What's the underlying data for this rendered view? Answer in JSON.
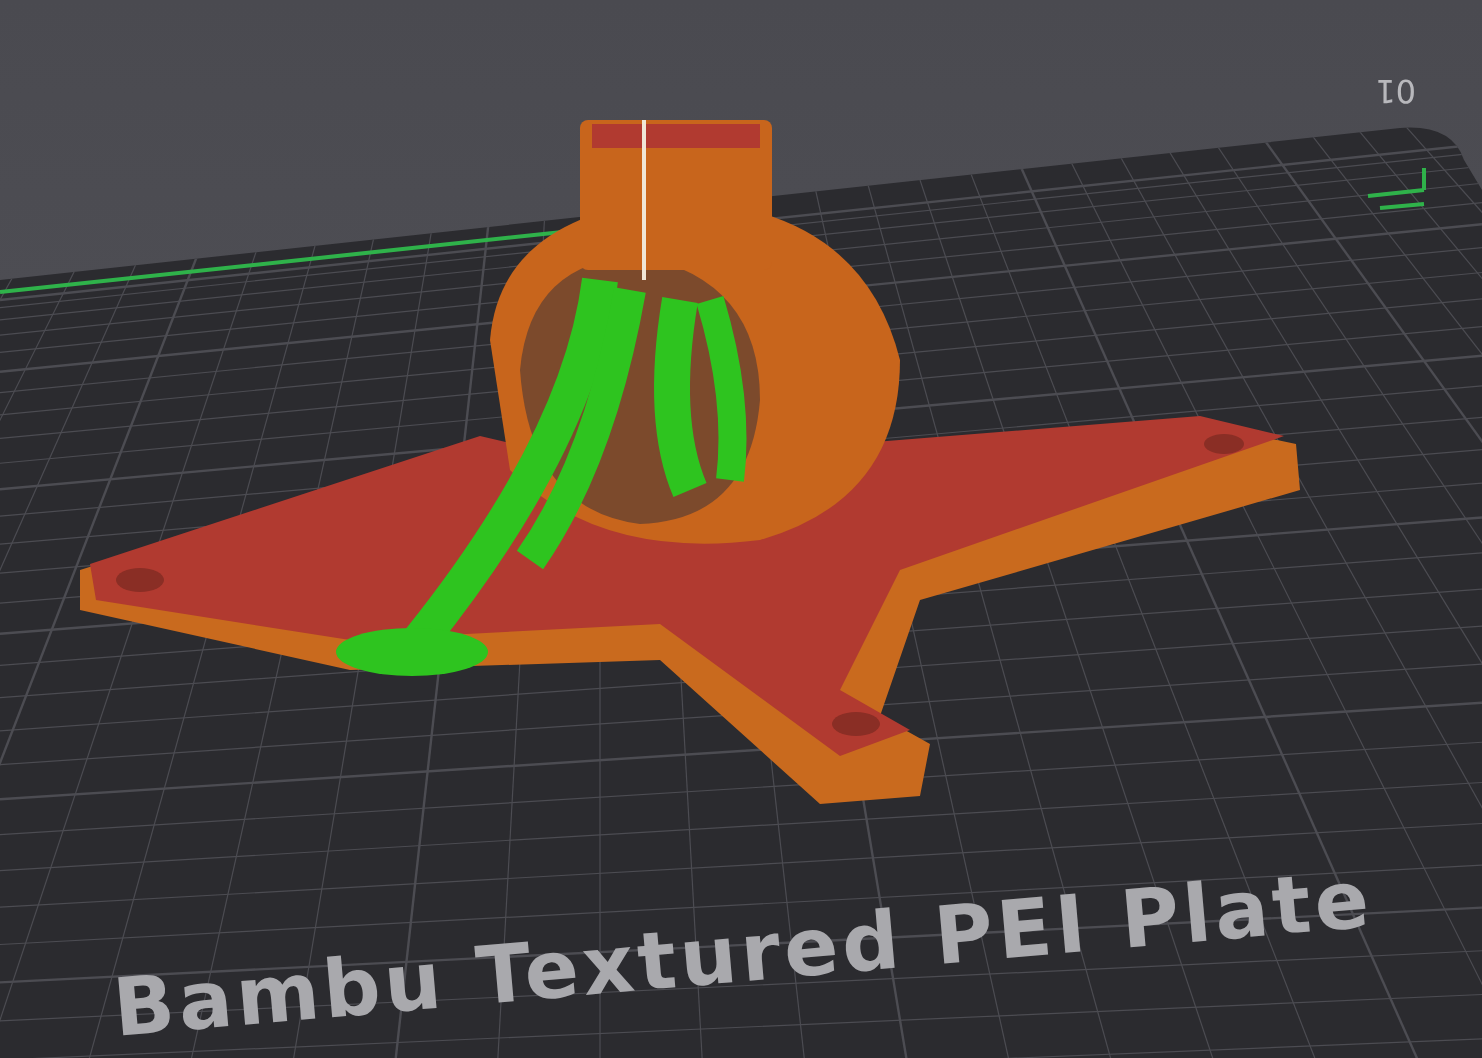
{
  "plate": {
    "label": "Bambu Textured PEI Plate",
    "number": "01"
  }
}
